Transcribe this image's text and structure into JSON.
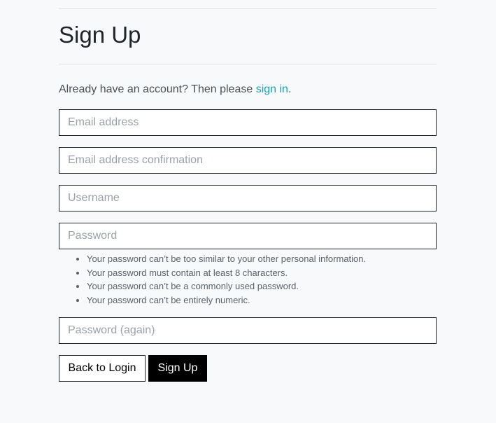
{
  "page": {
    "title": "Sign Up",
    "intro_text": "Already have an account? Then please ",
    "intro_link": "sign in",
    "intro_end": "."
  },
  "form": {
    "email_placeholder": "Email address",
    "email_confirm_placeholder": "Email address confirmation",
    "username_placeholder": "Username",
    "password_placeholder": "Password",
    "password_again_placeholder": "Password (again)",
    "password_help": [
      "Your password can’t be too similar to your other personal information.",
      "Your password must contain at least 8 characters.",
      "Your password can’t be a commonly used password.",
      "Your password can’t be entirely numeric."
    ]
  },
  "buttons": {
    "back_label": "Back to Login",
    "signup_label": "Sign Up"
  }
}
